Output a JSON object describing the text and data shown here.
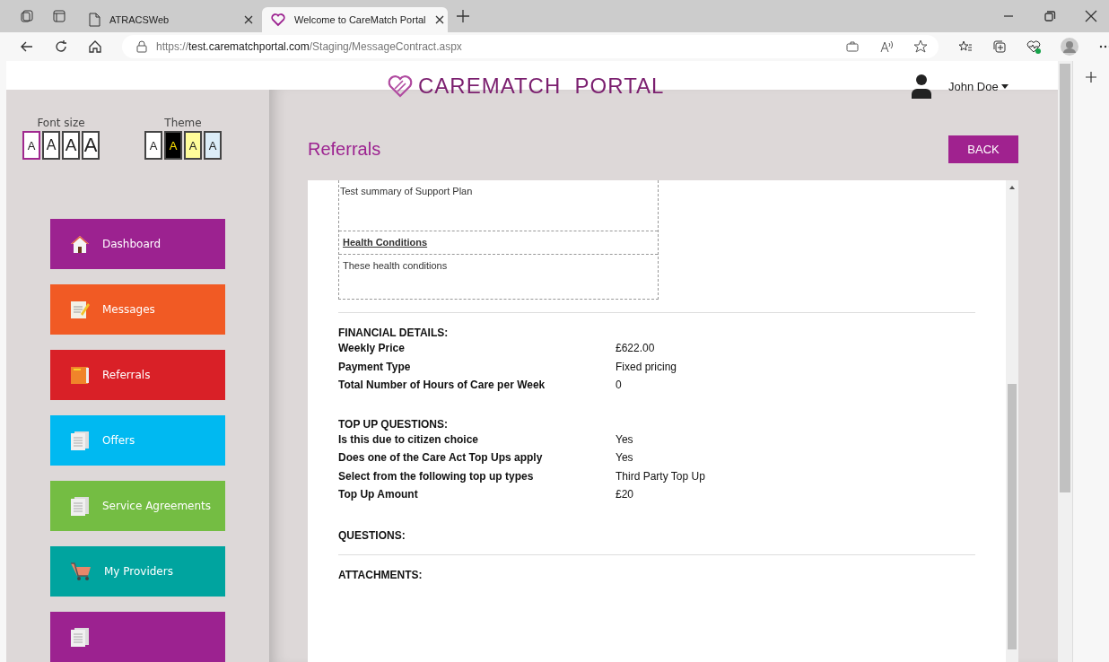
{
  "browser": {
    "tabs": [
      {
        "label": "ATRACSWeb",
        "selected": false
      },
      {
        "label": "Welcome to CareMatch Portal",
        "selected": true
      }
    ],
    "url": {
      "scheme": "https://",
      "host": "test.carematchportal.com",
      "path": "/Staging/MessageContract.aspx"
    }
  },
  "header": {
    "logo": "CAREMATCH  PORTAL",
    "user": "John Doe"
  },
  "font_size": {
    "label": "Font size",
    "options": [
      {
        "label": "A",
        "selected": true
      },
      {
        "label": "A",
        "selected": false
      },
      {
        "label": "A",
        "selected": false
      },
      {
        "label": "A",
        "selected": false
      }
    ]
  },
  "theme": {
    "label": "Theme",
    "options": [
      {
        "label": "A",
        "color": "#ffffff"
      },
      {
        "label": "A",
        "color": "#000000"
      },
      {
        "label": "A",
        "color": "#fffd9a"
      },
      {
        "label": "A",
        "color": "#dcedf8"
      }
    ]
  },
  "nav": [
    {
      "label": "Dashboard",
      "kind": "home",
      "color": "#9c2290"
    },
    {
      "label": "Messages",
      "kind": "note",
      "color": "#f15a24"
    },
    {
      "label": "Referrals",
      "kind": "folder",
      "color": "#d92027"
    },
    {
      "label": "Offers",
      "kind": "document",
      "color": "#00b9f1"
    },
    {
      "label": "Service Agreements",
      "kind": "document",
      "color": "#74bd43"
    },
    {
      "label": "My Providers",
      "kind": "cart",
      "color": "#00a49f"
    },
    {
      "kind": "document",
      "color": "#9c2290"
    }
  ],
  "page": {
    "title": "Referrals",
    "back": "BACK",
    "plan_table": [
      {
        "text": "Test summary of Support Plan",
        "kind": "text"
      },
      {
        "text": "Health Conditions",
        "kind": "heading"
      },
      {
        "text": "These health conditions",
        "kind": "text"
      }
    ],
    "sections": [
      {
        "title": "FINANCIAL DETAILS:",
        "rows": [
          {
            "label": "Weekly Price",
            "value": "£622.00"
          },
          {
            "label": "Payment Type",
            "value": "Fixed pricing"
          },
          {
            "label": "Total Number of Hours of Care per Week",
            "value": "0"
          }
        ]
      },
      {
        "title": "TOP UP QUESTIONS:",
        "rows": [
          {
            "label": "Is this due to citizen choice",
            "value": "Yes"
          },
          {
            "label": "Does one of the Care Act Top Ups apply",
            "value": "Yes"
          },
          {
            "label": "Select from the following top up types",
            "value": "Third Party Top Up"
          },
          {
            "label": "Top Up Amount",
            "value": "£20"
          }
        ]
      },
      {
        "title": "QUESTIONS:"
      },
      {
        "title": "ATTACHMENTS:"
      }
    ]
  }
}
